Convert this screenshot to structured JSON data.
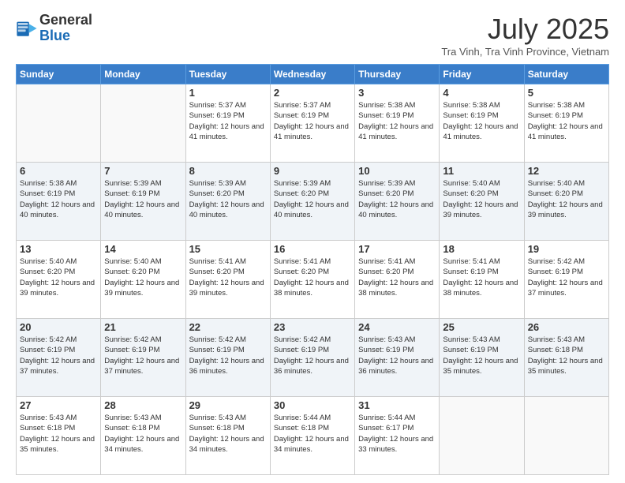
{
  "logo": {
    "general": "General",
    "blue": "Blue"
  },
  "header": {
    "month_year": "July 2025",
    "location": "Tra Vinh, Tra Vinh Province, Vietnam"
  },
  "days_of_week": [
    "Sunday",
    "Monday",
    "Tuesday",
    "Wednesday",
    "Thursday",
    "Friday",
    "Saturday"
  ],
  "weeks": [
    [
      {
        "day": "",
        "info": ""
      },
      {
        "day": "",
        "info": ""
      },
      {
        "day": "1",
        "info": "Sunrise: 5:37 AM\nSunset: 6:19 PM\nDaylight: 12 hours and 41 minutes."
      },
      {
        "day": "2",
        "info": "Sunrise: 5:37 AM\nSunset: 6:19 PM\nDaylight: 12 hours and 41 minutes."
      },
      {
        "day": "3",
        "info": "Sunrise: 5:38 AM\nSunset: 6:19 PM\nDaylight: 12 hours and 41 minutes."
      },
      {
        "day": "4",
        "info": "Sunrise: 5:38 AM\nSunset: 6:19 PM\nDaylight: 12 hours and 41 minutes."
      },
      {
        "day": "5",
        "info": "Sunrise: 5:38 AM\nSunset: 6:19 PM\nDaylight: 12 hours and 41 minutes."
      }
    ],
    [
      {
        "day": "6",
        "info": "Sunrise: 5:38 AM\nSunset: 6:19 PM\nDaylight: 12 hours and 40 minutes."
      },
      {
        "day": "7",
        "info": "Sunrise: 5:39 AM\nSunset: 6:19 PM\nDaylight: 12 hours and 40 minutes."
      },
      {
        "day": "8",
        "info": "Sunrise: 5:39 AM\nSunset: 6:20 PM\nDaylight: 12 hours and 40 minutes."
      },
      {
        "day": "9",
        "info": "Sunrise: 5:39 AM\nSunset: 6:20 PM\nDaylight: 12 hours and 40 minutes."
      },
      {
        "day": "10",
        "info": "Sunrise: 5:39 AM\nSunset: 6:20 PM\nDaylight: 12 hours and 40 minutes."
      },
      {
        "day": "11",
        "info": "Sunrise: 5:40 AM\nSunset: 6:20 PM\nDaylight: 12 hours and 39 minutes."
      },
      {
        "day": "12",
        "info": "Sunrise: 5:40 AM\nSunset: 6:20 PM\nDaylight: 12 hours and 39 minutes."
      }
    ],
    [
      {
        "day": "13",
        "info": "Sunrise: 5:40 AM\nSunset: 6:20 PM\nDaylight: 12 hours and 39 minutes."
      },
      {
        "day": "14",
        "info": "Sunrise: 5:40 AM\nSunset: 6:20 PM\nDaylight: 12 hours and 39 minutes."
      },
      {
        "day": "15",
        "info": "Sunrise: 5:41 AM\nSunset: 6:20 PM\nDaylight: 12 hours and 39 minutes."
      },
      {
        "day": "16",
        "info": "Sunrise: 5:41 AM\nSunset: 6:20 PM\nDaylight: 12 hours and 38 minutes."
      },
      {
        "day": "17",
        "info": "Sunrise: 5:41 AM\nSunset: 6:20 PM\nDaylight: 12 hours and 38 minutes."
      },
      {
        "day": "18",
        "info": "Sunrise: 5:41 AM\nSunset: 6:19 PM\nDaylight: 12 hours and 38 minutes."
      },
      {
        "day": "19",
        "info": "Sunrise: 5:42 AM\nSunset: 6:19 PM\nDaylight: 12 hours and 37 minutes."
      }
    ],
    [
      {
        "day": "20",
        "info": "Sunrise: 5:42 AM\nSunset: 6:19 PM\nDaylight: 12 hours and 37 minutes."
      },
      {
        "day": "21",
        "info": "Sunrise: 5:42 AM\nSunset: 6:19 PM\nDaylight: 12 hours and 37 minutes."
      },
      {
        "day": "22",
        "info": "Sunrise: 5:42 AM\nSunset: 6:19 PM\nDaylight: 12 hours and 36 minutes."
      },
      {
        "day": "23",
        "info": "Sunrise: 5:42 AM\nSunset: 6:19 PM\nDaylight: 12 hours and 36 minutes."
      },
      {
        "day": "24",
        "info": "Sunrise: 5:43 AM\nSunset: 6:19 PM\nDaylight: 12 hours and 36 minutes."
      },
      {
        "day": "25",
        "info": "Sunrise: 5:43 AM\nSunset: 6:19 PM\nDaylight: 12 hours and 35 minutes."
      },
      {
        "day": "26",
        "info": "Sunrise: 5:43 AM\nSunset: 6:18 PM\nDaylight: 12 hours and 35 minutes."
      }
    ],
    [
      {
        "day": "27",
        "info": "Sunrise: 5:43 AM\nSunset: 6:18 PM\nDaylight: 12 hours and 35 minutes."
      },
      {
        "day": "28",
        "info": "Sunrise: 5:43 AM\nSunset: 6:18 PM\nDaylight: 12 hours and 34 minutes."
      },
      {
        "day": "29",
        "info": "Sunrise: 5:43 AM\nSunset: 6:18 PM\nDaylight: 12 hours and 34 minutes."
      },
      {
        "day": "30",
        "info": "Sunrise: 5:44 AM\nSunset: 6:18 PM\nDaylight: 12 hours and 34 minutes."
      },
      {
        "day": "31",
        "info": "Sunrise: 5:44 AM\nSunset: 6:17 PM\nDaylight: 12 hours and 33 minutes."
      },
      {
        "day": "",
        "info": ""
      },
      {
        "day": "",
        "info": ""
      }
    ]
  ]
}
